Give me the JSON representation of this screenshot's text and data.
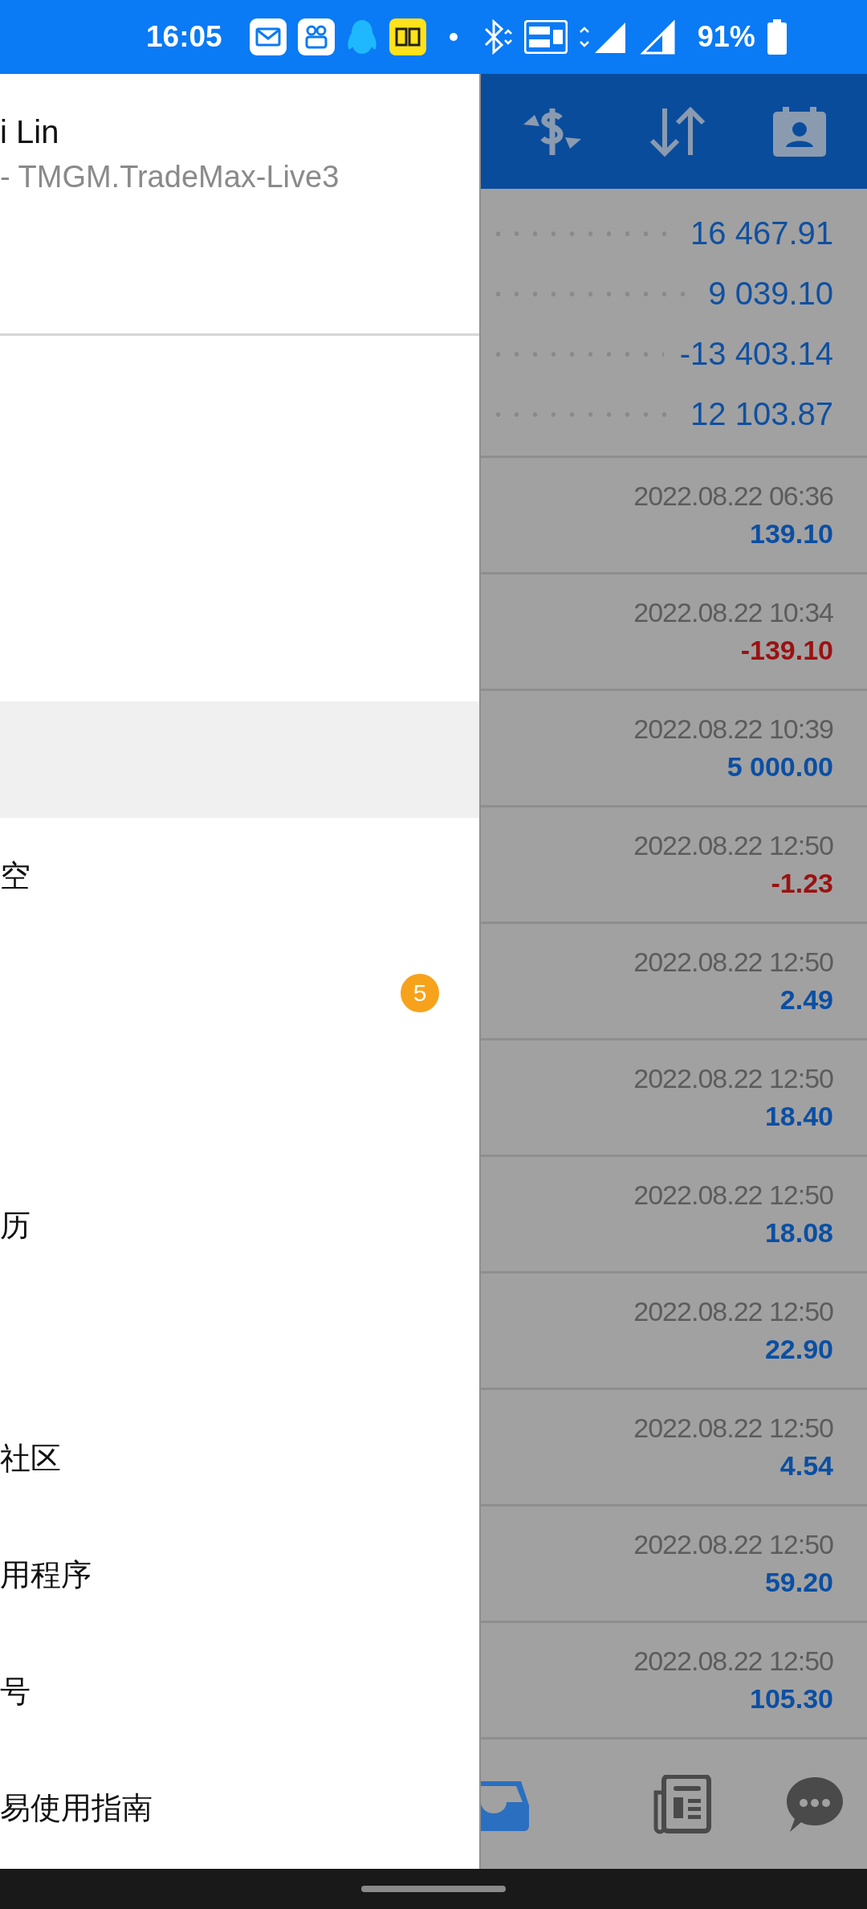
{
  "status_bar": {
    "time": "16:05",
    "battery": "91%"
  },
  "drawer": {
    "account_name": "i Lin",
    "server": "- TMGM.TradeMax-Live3",
    "menu": [
      {
        "kind": "blank"
      },
      {
        "kind": "blank"
      },
      {
        "kind": "blank"
      },
      {
        "kind": "entry",
        "selected": true
      },
      {
        "kind": "entry",
        "label": "空",
        "selected": false
      },
      {
        "kind": "entry",
        "selected": false,
        "badge": "5"
      },
      {
        "kind": "blank"
      },
      {
        "kind": "entry",
        "label": "历",
        "selected": false
      },
      {
        "kind": "blank"
      },
      {
        "kind": "entry",
        "label": "社区",
        "selected": false
      },
      {
        "kind": "entry",
        "label": "用程序",
        "selected": false
      },
      {
        "kind": "entry",
        "label": "号",
        "selected": false
      },
      {
        "kind": "entry",
        "label": "易使用指南",
        "selected": false
      }
    ]
  },
  "summary": [
    "16 467.91",
    "9 039.10",
    "-13 403.14",
    "12 103.87"
  ],
  "deals": [
    {
      "time": "2022.08.22 06:36",
      "amount": "139.10",
      "kind": "credit"
    },
    {
      "time": "2022.08.22 10:34",
      "amount": "-139.10",
      "kind": "debit"
    },
    {
      "time": "2022.08.22 10:39",
      "amount": "5 000.00",
      "kind": "credit"
    },
    {
      "time": "2022.08.22 12:50",
      "amount": "-1.23",
      "kind": "debit"
    },
    {
      "time": "2022.08.22 12:50",
      "amount": "2.49",
      "kind": "credit"
    },
    {
      "time": "2022.08.22 12:50",
      "amount": "18.40",
      "kind": "credit"
    },
    {
      "time": "2022.08.22 12:50",
      "amount": "18.08",
      "kind": "credit"
    },
    {
      "time": "2022.08.22 12:50",
      "amount": "22.90",
      "kind": "credit"
    },
    {
      "time": "2022.08.22 12:50",
      "amount": "4.54",
      "kind": "credit"
    },
    {
      "time": "2022.08.22 12:50",
      "amount": "59.20",
      "kind": "credit"
    },
    {
      "time": "2022.08.22 12:50",
      "amount": "105.30",
      "kind": "credit"
    }
  ],
  "bottom_tabs": [
    {
      "kind": "inbox",
      "selected": true
    },
    {
      "kind": "news",
      "selected": false
    },
    {
      "kind": "chat",
      "selected": false
    }
  ]
}
